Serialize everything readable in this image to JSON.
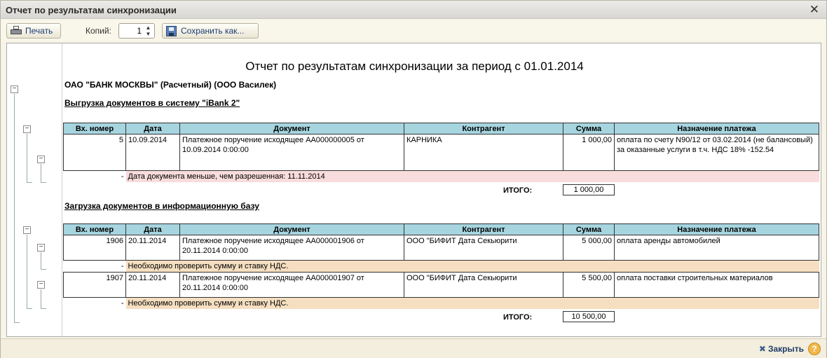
{
  "window": {
    "title": "Отчет по результатам синхронизации",
    "close_symbol": "✕"
  },
  "toolbar": {
    "print_label": "Печать",
    "copies_label": "Копий:",
    "copies_value": "1",
    "save_as_label": "Сохранить как..."
  },
  "report": {
    "title": "Отчет по результатам синхронизации за период с 01.01.2014",
    "bank_line": "ОАО \"БАНК МОСКВЫ\" (Расчетный) (ООО Василек)",
    "section1": {
      "heading": "Выгрузка документов в систему \"iBank 2\"",
      "columns": [
        "Вх. номер",
        "Дата",
        "Документ",
        "Контрагент",
        "Сумма",
        "Назначение платежа"
      ],
      "rows": [
        {
          "num": "5",
          "date": "10.09.2014",
          "doc": "Платежное поручение исходящее АА000000005 от 10.09.2014 0:00:00",
          "contractor": "КАРНИКА",
          "sum": "1 000,00",
          "purpose": "оплата по счету N90/12 от 03.02.2014 (не балансовый) за оказанные услуги в т.ч. НДС 18% -152.54",
          "warn_dash": "-",
          "warning": "Дата документа меньше, чем разрешенная: 11.11.2014"
        }
      ],
      "total_label": "ИТОГО:",
      "total_value": "1 000,00"
    },
    "section2": {
      "heading": "Загрузка документов в информационную базу",
      "columns": [
        "Вх. номер",
        "Дата",
        "Документ",
        "Контрагент",
        "Сумма",
        "Назначение платежа"
      ],
      "rows": [
        {
          "num": "1906",
          "date": "20.11.2014",
          "doc": "Платежное поручение исходящее АА000001906 от 20.11.2014 0:00:00",
          "contractor": "ООО \"БИФИТ Дата Секьюрити",
          "sum": "5 000,00",
          "purpose": "оплата аренды автомобилей",
          "warn_dash": "-",
          "warning": "Необходимо проверить сумму и ставку НДС."
        },
        {
          "num": "1907",
          "date": "20.11.2014",
          "doc": "Платежное поручение исходящее АА000001907 от 20.11.2014 0:00:00",
          "contractor": "ООО \"БИФИТ Дата Секьюрити",
          "sum": "5 500,00",
          "purpose": "оплата поставки строительных материалов",
          "warn_dash": "-",
          "warning": "Необходимо проверить сумму и ставку НДС."
        }
      ],
      "total_label": "ИТОГО:",
      "total_value": "10 500,00"
    }
  },
  "footer": {
    "close_label": "Закрыть",
    "close_symbol": "✖",
    "help_symbol": "?"
  },
  "colors": {
    "header_bg": "#a6d5df",
    "warn_pink": "#f9dcdc",
    "warn_orange": "#f5dfc0",
    "window_bg": "#f7f4e8"
  }
}
